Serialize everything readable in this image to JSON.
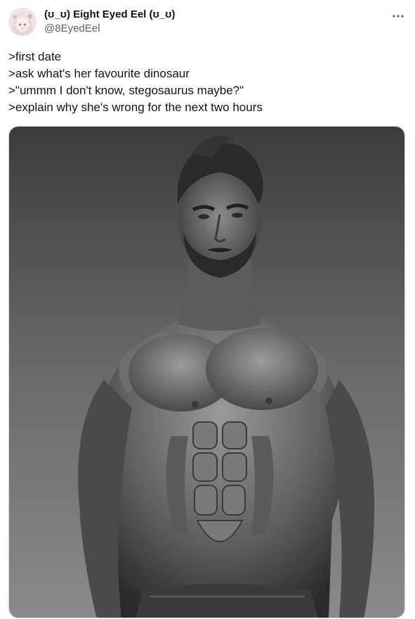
{
  "author": {
    "display_name": "(ʊ_ʊ) Eight Eyed Eel (ʊ_ʊ)",
    "handle": "@8EyedEel"
  },
  "icons": {
    "avatar": "anime-girl-avatar",
    "more": "more-horizontal-icon"
  },
  "tweet": {
    "lines": [
      ">first date",
      ">ask what's her favourite dinosaur",
      ">\"ummm I don't know, stegosaurus maybe?\"",
      ">explain why she's wrong for the next two hours"
    ]
  },
  "media": {
    "type": "photo",
    "subject": "grayscale photo of a muscular bearded man"
  },
  "colors": {
    "text_primary": "#0f1419",
    "text_secondary": "#536471",
    "border": "#cfd9de"
  }
}
